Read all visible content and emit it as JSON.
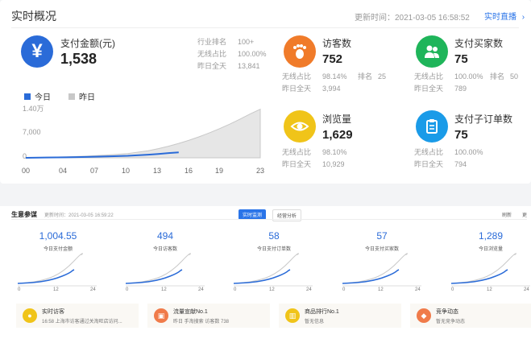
{
  "header": {
    "title": "实时概况",
    "update_label": "更新时间：2021-03-05 16:58:52",
    "live_link": "实时直播",
    "live_chevron": "›"
  },
  "payment": {
    "icon": "yen-icon",
    "icon_glyph": "¥",
    "label": "支付金额(元)",
    "value": "1,538",
    "rank_label": "行业排名",
    "rank_value": "100+",
    "wireless_label": "无线占比",
    "wireless_value": "100.00%",
    "yesterday_label": "昨日全天",
    "yesterday_value": "13,841"
  },
  "chart": {
    "legend_today": "今日",
    "legend_yesterday": "昨日",
    "y_ticks": [
      "1.40万",
      "7,000",
      "0"
    ],
    "x_ticks": [
      "00",
      "04",
      "07",
      "10",
      "13",
      "16",
      "19",
      "23"
    ],
    "colors": {
      "today": "#2a6bd8",
      "yesterday": "#c8c8c8"
    }
  },
  "chart_data": {
    "type": "area",
    "x": [
      0,
      2,
      4,
      6,
      8,
      10,
      12,
      13,
      14,
      15,
      16,
      17,
      18,
      19,
      20,
      21,
      22,
      23
    ],
    "ylim": [
      0,
      14000
    ],
    "series": [
      {
        "name": "今日",
        "values": [
          0,
          80,
          150,
          260,
          400,
          560,
          900,
          1100,
          1350,
          1538
        ]
      },
      {
        "name": "昨日",
        "values": [
          0,
          150,
          300,
          500,
          800,
          1200,
          2000,
          2600,
          3300,
          4100,
          5000,
          6000,
          7100,
          8300,
          9600,
          11000,
          12500,
          13841
        ]
      }
    ]
  },
  "metrics": {
    "visitors": {
      "label": "访客数",
      "value": "752",
      "l1": "无线占比",
      "v1": "98.14%",
      "rank_label": "排名",
      "rank_value": "25",
      "l2": "昨日全天",
      "v2": "3,994",
      "color": "#f07b2a",
      "icon": "footprint-icon"
    },
    "buyers": {
      "label": "支付买家数",
      "value": "75",
      "l1": "无线占比",
      "v1": "100.00%",
      "rank_label": "排名",
      "rank_value": "50",
      "l2": "昨日全天",
      "v2": "789",
      "color": "#1fb55a",
      "icon": "users-icon"
    },
    "pageviews": {
      "label": "浏览量",
      "value": "1,629",
      "l1": "无线占比",
      "v1": "98.10%",
      "l2": "昨日全天",
      "v2": "10,929",
      "color": "#f0c419",
      "icon": "eye-icon"
    },
    "orders": {
      "label": "支付子订单数",
      "value": "75",
      "l1": "无线占比",
      "v1": "100.00%",
      "l2": "昨日全天",
      "v2": "794",
      "color": "#1a9be8",
      "icon": "clipboard-icon"
    }
  },
  "biz": {
    "title": "生意参谋",
    "update_label": "更新时间：2021-03-05 16:59:22",
    "tab_live": "实时监测",
    "tab_analysis": "经营分析",
    "refresh": "刷新",
    "more": "更",
    "kpis": [
      {
        "value": "1,004.55",
        "label": "今日支付金额"
      },
      {
        "value": "494",
        "label": "今日访客数"
      },
      {
        "value": "58",
        "label": "今日支付订单数"
      },
      {
        "value": "57",
        "label": "今日支付买家数"
      },
      {
        "value": "1,289",
        "label": "今日浏览量"
      }
    ],
    "mini_ticks": [
      "0",
      "12",
      "24"
    ],
    "alerts": [
      {
        "title": "实时访客",
        "sub": "16:58 上海市访客通过关淘旺店访问...",
        "color": "#f0c419",
        "icon": "user-icon",
        "glyph": "●"
      },
      {
        "title": "流量宣献No.1",
        "sub": "昨日 手淘搜索 访客数 738",
        "color": "#f07b4a",
        "icon": "traffic-icon",
        "glyph": "▣"
      },
      {
        "title": "商品排行No.1",
        "sub": "暂无信息",
        "color": "#f0c419",
        "icon": "bar-chart-icon",
        "glyph": "▥"
      },
      {
        "title": "竞争动态",
        "sub": "暂无竞争动态",
        "color": "#f07b4a",
        "icon": "flame-icon",
        "glyph": "◆"
      }
    ]
  }
}
